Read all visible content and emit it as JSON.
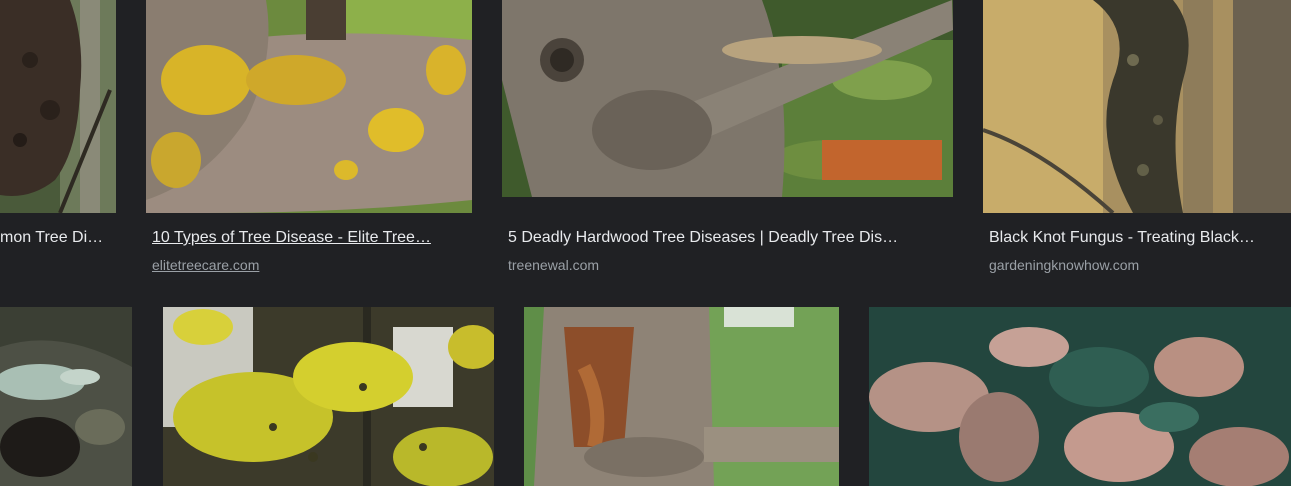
{
  "results_row1": [
    {
      "title": "mon Tree Di…",
      "source": ""
    },
    {
      "title": "10 Types of Tree Disease - Elite Tree…",
      "source": "elitetreecare.com"
    },
    {
      "title": "5 Deadly Hardwood Tree Diseases | Deadly Tree Dis…",
      "source": "treenewal.com"
    },
    {
      "title": "Black Knot Fungus - Treating Black…",
      "source": "gardeningknowhow.com"
    }
  ],
  "images": [
    {
      "icon": "burl-trunk-image"
    },
    {
      "icon": "lichen-branch-image"
    },
    {
      "icon": "bark-canker-image"
    },
    {
      "icon": "black-knot-image"
    },
    {
      "icon": "lichen-log-image"
    },
    {
      "icon": "yellow-maple-leaves-image"
    },
    {
      "icon": "decayed-trunk-image"
    },
    {
      "icon": "spotted-leaves-image"
    }
  ],
  "colors": {
    "background": "#202124",
    "title_text": "#e8eaed",
    "source_text": "#9aa0a6"
  }
}
